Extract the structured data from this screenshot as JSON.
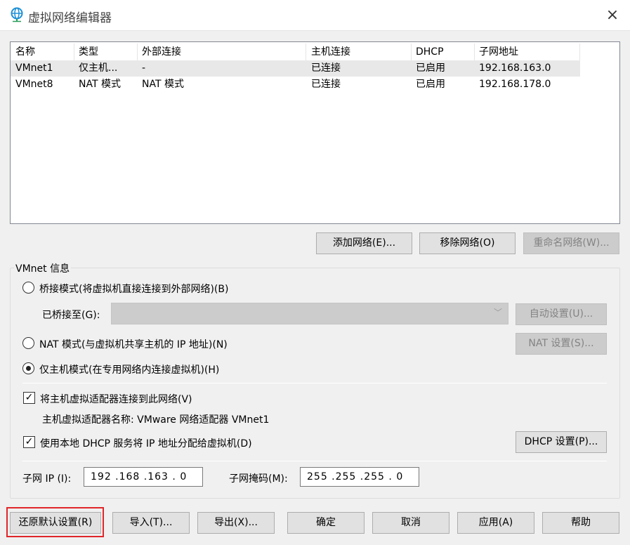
{
  "window": {
    "title": "虚拟网络编辑器",
    "close_icon": "×"
  },
  "table": {
    "columns": [
      "名称",
      "类型",
      "外部连接",
      "主机连接",
      "DHCP",
      "子网地址"
    ],
    "rows": [
      [
        "VMnet1",
        "仅主机...",
        "-",
        "已连接",
        "已启用",
        "192.168.163.0"
      ],
      [
        "VMnet8",
        "NAT 模式",
        "NAT 模式",
        "已连接",
        "已启用",
        "192.168.178.0"
      ]
    ]
  },
  "list_buttons": {
    "add": "添加网络(E)...",
    "remove": "移除网络(O)",
    "rename": "重命名网络(W)..."
  },
  "vmnet_info": {
    "label": "VMnet 信息",
    "bridge_radio": "桥接模式(将虚拟机直接连接到外部网络)(B)",
    "bridged_to_label": "已桥接至(G):",
    "bridged_to_value": "",
    "auto_settings": "自动设置(U)...",
    "nat_radio": "NAT 模式(与虚拟机共享主机的 IP 地址)(N)",
    "nat_settings": "NAT 设置(S)...",
    "hostonly_radio": "仅主机模式(在专用网络内连接虚拟机)(H)",
    "selected_mode": "hostonly",
    "connect_adapter": "将主机虚拟适配器连接到此网络(V)",
    "connect_adapter_checked": true,
    "adapter_name": "主机虚拟适配器名称: VMware 网络适配器 VMnet1",
    "use_dhcp": "使用本地 DHCP 服务将 IP 地址分配给虚拟机(D)",
    "use_dhcp_checked": true,
    "dhcp_settings": "DHCP 设置(P)...",
    "subnet_ip_label": "子网 IP (I):",
    "subnet_ip": "192 .168 .163 .  0",
    "subnet_mask_label": "子网掩码(M):",
    "subnet_mask": "255 .255 .255 .  0"
  },
  "footer": {
    "restore": "还原默认设置(R)",
    "import": "导入(T)...",
    "export": "导出(X)...",
    "ok": "确定",
    "cancel": "取消",
    "apply": "应用(A)",
    "help": "帮助"
  },
  "colors": {
    "highlight": "#e0262a",
    "row_selected": "#e8e8e8",
    "icon": "#1e90d6"
  }
}
